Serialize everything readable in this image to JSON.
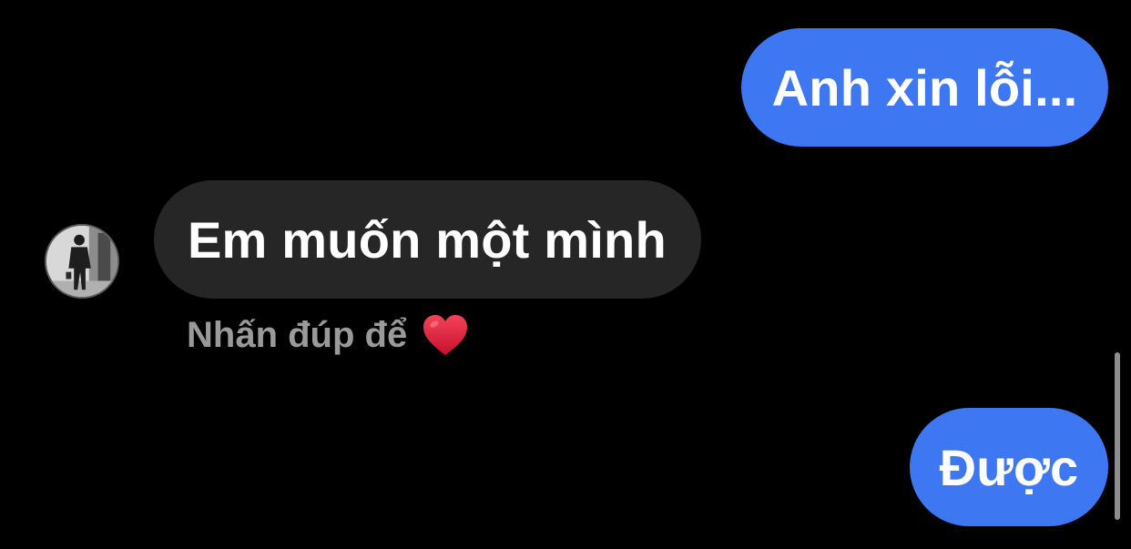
{
  "messages": [
    {
      "sender": "me",
      "text": "Anh xin lỗi..."
    },
    {
      "sender": "them",
      "text": "Em muốn một mình",
      "hint": "Nhấn đúp để",
      "hint_icon": "heart-icon"
    },
    {
      "sender": "me",
      "text": "Được"
    }
  ],
  "colors": {
    "background": "#000000",
    "sent_bubble": "#3d77f1",
    "received_bubble": "#262626",
    "hint_text": "#9a9a9a",
    "heart": "#e0233a"
  },
  "avatar": {
    "icon": "profile-photo"
  }
}
